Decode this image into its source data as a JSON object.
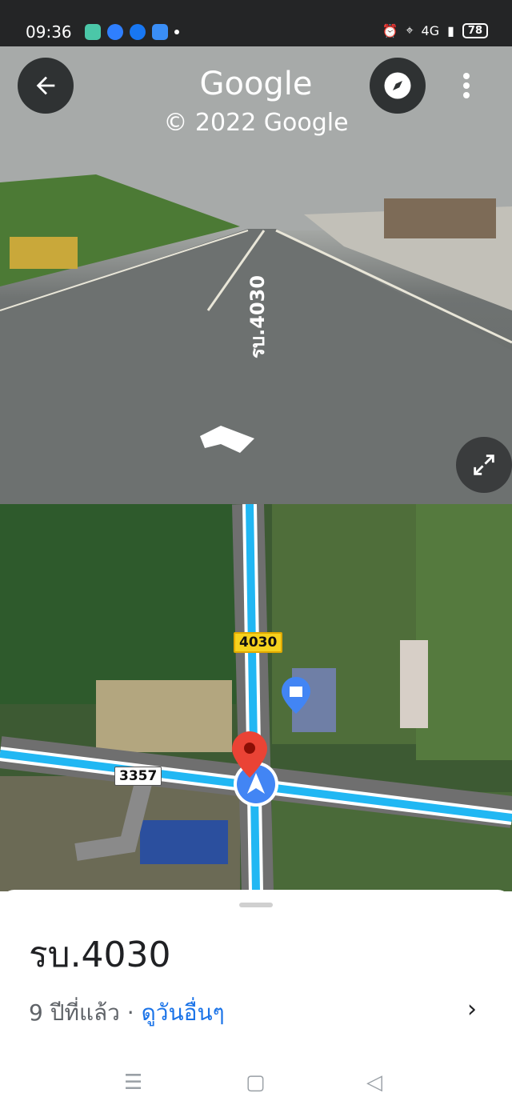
{
  "status_bar": {
    "time": "09:36",
    "network": "4G",
    "battery": "78",
    "app_icons": [
      "gallery-icon",
      "messenger-icon",
      "facebook-icon",
      "app-icon"
    ]
  },
  "street_view": {
    "brand": "Google",
    "copyright": "© 2022 Google",
    "road_label": "รบ.4030",
    "icons": {
      "back": "arrow-left-icon",
      "compass": "compass-icon",
      "more": "more-vertical-icon",
      "expand": "expand-icon"
    }
  },
  "map": {
    "route_main": "4030",
    "route_side": "3357",
    "colors": {
      "road": "#21b7f3",
      "pin": "#ea4335",
      "location": "#4285f4"
    }
  },
  "place": {
    "title": "รบ.4030",
    "age": "9 ปีที่แล้ว",
    "separator": " · ",
    "see_other_dates": "ดูวันอื่นๆ"
  },
  "nav_bar": {
    "menu": "☰",
    "home": "▢",
    "back": "◁"
  }
}
